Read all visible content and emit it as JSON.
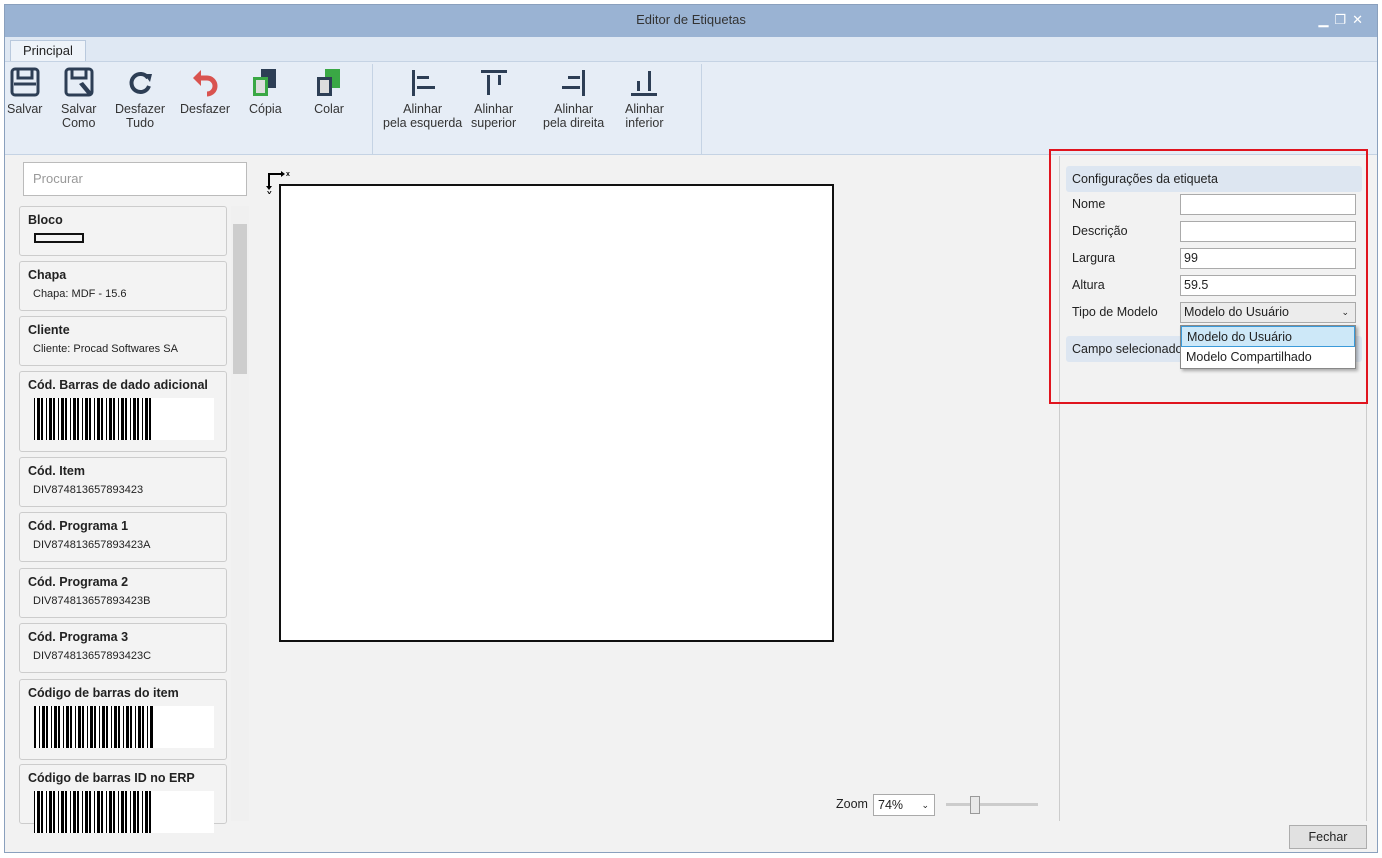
{
  "window": {
    "title": "Editor de Etiquetas",
    "controls": [
      "minimize",
      "restore",
      "close"
    ]
  },
  "ribbon": {
    "tab": "Principal",
    "buttons": [
      {
        "label": "Salvar",
        "icon": "save-icon"
      },
      {
        "label": "Salvar\nComo",
        "icon": "save-as-icon"
      },
      {
        "label": "Desfazer\nTudo",
        "icon": "undo-all-icon"
      },
      {
        "label": "Desfazer",
        "icon": "undo-icon"
      },
      {
        "label": "Cópia",
        "icon": "copy-icon"
      },
      {
        "label": "Colar",
        "icon": "paste-icon"
      },
      {
        "label": "Alinhar\npela esquerda",
        "icon": "align-left-icon"
      },
      {
        "label": "Alinhar\nsuperior",
        "icon": "align-top-icon"
      },
      {
        "label": "Alinhar\npela direita",
        "icon": "align-right-icon"
      },
      {
        "label": "Alinhar\ninferior",
        "icon": "align-bottom-icon"
      }
    ]
  },
  "fields": {
    "search_placeholder": "Procurar",
    "items": [
      {
        "title": "Bloco",
        "type": "block"
      },
      {
        "title": "Chapa",
        "sub": "Chapa: MDF - 15.6"
      },
      {
        "title": "Cliente",
        "sub": "Cliente: Procad Softwares SA"
      },
      {
        "title": "Cód. Barras de dado adicional",
        "type": "barcode"
      },
      {
        "title": "Cód. Item",
        "sub": "DIV874813657893423"
      },
      {
        "title": "Cód. Programa 1",
        "sub": "DIV874813657893423A"
      },
      {
        "title": "Cód. Programa 2",
        "sub": "DIV874813657893423B"
      },
      {
        "title": "Cód. Programa 3",
        "sub": "DIV874813657893423C"
      },
      {
        "title": "Código de barras do item",
        "type": "barcode"
      },
      {
        "title": "Código de barras ID no ERP",
        "type": "barcode"
      }
    ]
  },
  "canvas": {
    "axis_x": "x",
    "axis_y": "Y"
  },
  "settings": {
    "header": "Configurações da etiqueta",
    "nome_label": "Nome",
    "nome": "",
    "descricao_label": "Descrição",
    "descricao": "",
    "largura_label": "Largura",
    "largura": "99",
    "altura_label": "Altura",
    "altura": "59.5",
    "tipo_label": "Tipo de Modelo",
    "tipo": "Modelo do Usuário",
    "options": [
      "Modelo do Usuário",
      "Modelo Compartilhado"
    ],
    "campo_header": "Campo selecionado"
  },
  "footer": {
    "zoom_label": "Zoom",
    "zoom_value": "74%",
    "close": "Fechar"
  },
  "colors": {
    "titlebar": "#9ab3d3",
    "highlight": "#e0141e"
  }
}
